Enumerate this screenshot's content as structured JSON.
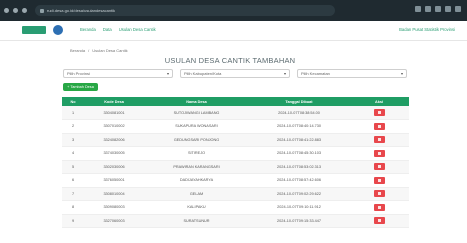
{
  "browser": {
    "url": "rudi.desa.go.id/desa/usulandesacantik"
  },
  "header": {
    "menu": [
      "Beranda",
      "Data",
      "Usulan Desa Cantik"
    ],
    "user": "Badan Pusat Statistik Provinsi"
  },
  "breadcrumb": [
    "Beranda",
    "/",
    "Usulan Desa Cantik"
  ],
  "page": {
    "title": "USULAN DESA CANTIK TAMBAHAN"
  },
  "filters": [
    {
      "placeholder": "Pilih Provinsi"
    },
    {
      "placeholder": "Pilih Kabupaten/Kota"
    },
    {
      "placeholder": "Pilih Kecamatan"
    }
  ],
  "add_button": "+ Tambah Desa",
  "table": {
    "headers": [
      "No",
      "Kode Desa",
      "Nama Desa",
      "Tanggal Dibuat",
      "Aksi"
    ],
    "rows": [
      {
        "no": "1",
        "kode": "3304081001",
        "nama": "SUTOJIWANGI LAMBANG",
        "tanggal": "2024-10-07T08:38:54.00"
      },
      {
        "no": "2",
        "kode": "3307010002",
        "nama": "SUKAPURA WONASARI",
        "tanggal": "2024-10-07T08:40:14.730"
      },
      {
        "no": "3",
        "kode": "3324082006",
        "nama": "GEDUNGSARI PONJONG",
        "tanggal": "2024-10-07T08:41:22.883"
      },
      {
        "no": "4",
        "kode": "3374030005",
        "nama": "SITIREJO",
        "tanggal": "2024-10-07T08:45:30.103"
      },
      {
        "no": "5",
        "kode": "3302030006",
        "nama": "PRAWIRAN KARANGSARI",
        "tanggal": "2024-10-07T08:53:02.313"
      },
      {
        "no": "6",
        "kode": "3376050001",
        "nama": "DADIJAYAHKARYA",
        "tanggal": "2024-10-07T08:57:42.606"
      },
      {
        "no": "7",
        "kode": "3308010004",
        "nama": "GELAM",
        "tanggal": "2024-10-07T09:02:29.622"
      },
      {
        "no": "8",
        "kode": "3309080003",
        "nama": "KALIPAKU",
        "tanggal": "2024-10-07T09:10:11.912"
      },
      {
        "no": "9",
        "kode": "3327060003",
        "nama": "SURATSUNUR",
        "tanggal": "2024-10-07T09:15:33.447"
      }
    ]
  }
}
